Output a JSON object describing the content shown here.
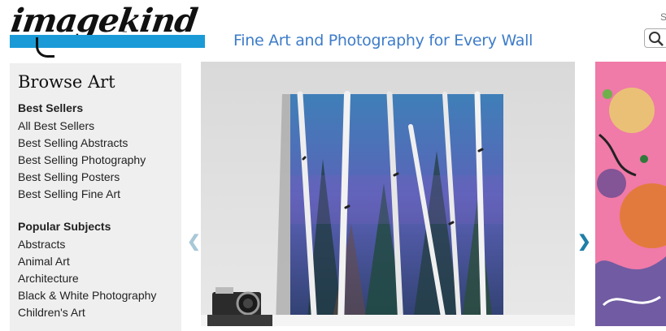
{
  "header": {
    "logo_text": "imagekind",
    "logo_tm": "™",
    "tagline": "Fine Art and Photography for Every Wall",
    "search_hint": "S"
  },
  "sidebar": {
    "title": "Browse Art",
    "sections": [
      {
        "heading": "Best Sellers",
        "items": [
          "All Best Sellers",
          "Best Selling Abstracts",
          "Best Selling Photography",
          "Best Selling Posters",
          "Best Selling Fine Art"
        ]
      },
      {
        "heading": "Popular Subjects",
        "items": [
          "Abstracts",
          "Animal Art",
          "Architecture",
          "Black & White Photography",
          "Children's Art"
        ]
      }
    ]
  },
  "carousel": {
    "prev_icon": "chevron-left-icon",
    "next_icon": "chevron-right-icon"
  },
  "colors": {
    "brand_blue": "#1a9bd7",
    "tagline_blue": "#3d7cc9",
    "sidebar_bg": "#efefef"
  }
}
